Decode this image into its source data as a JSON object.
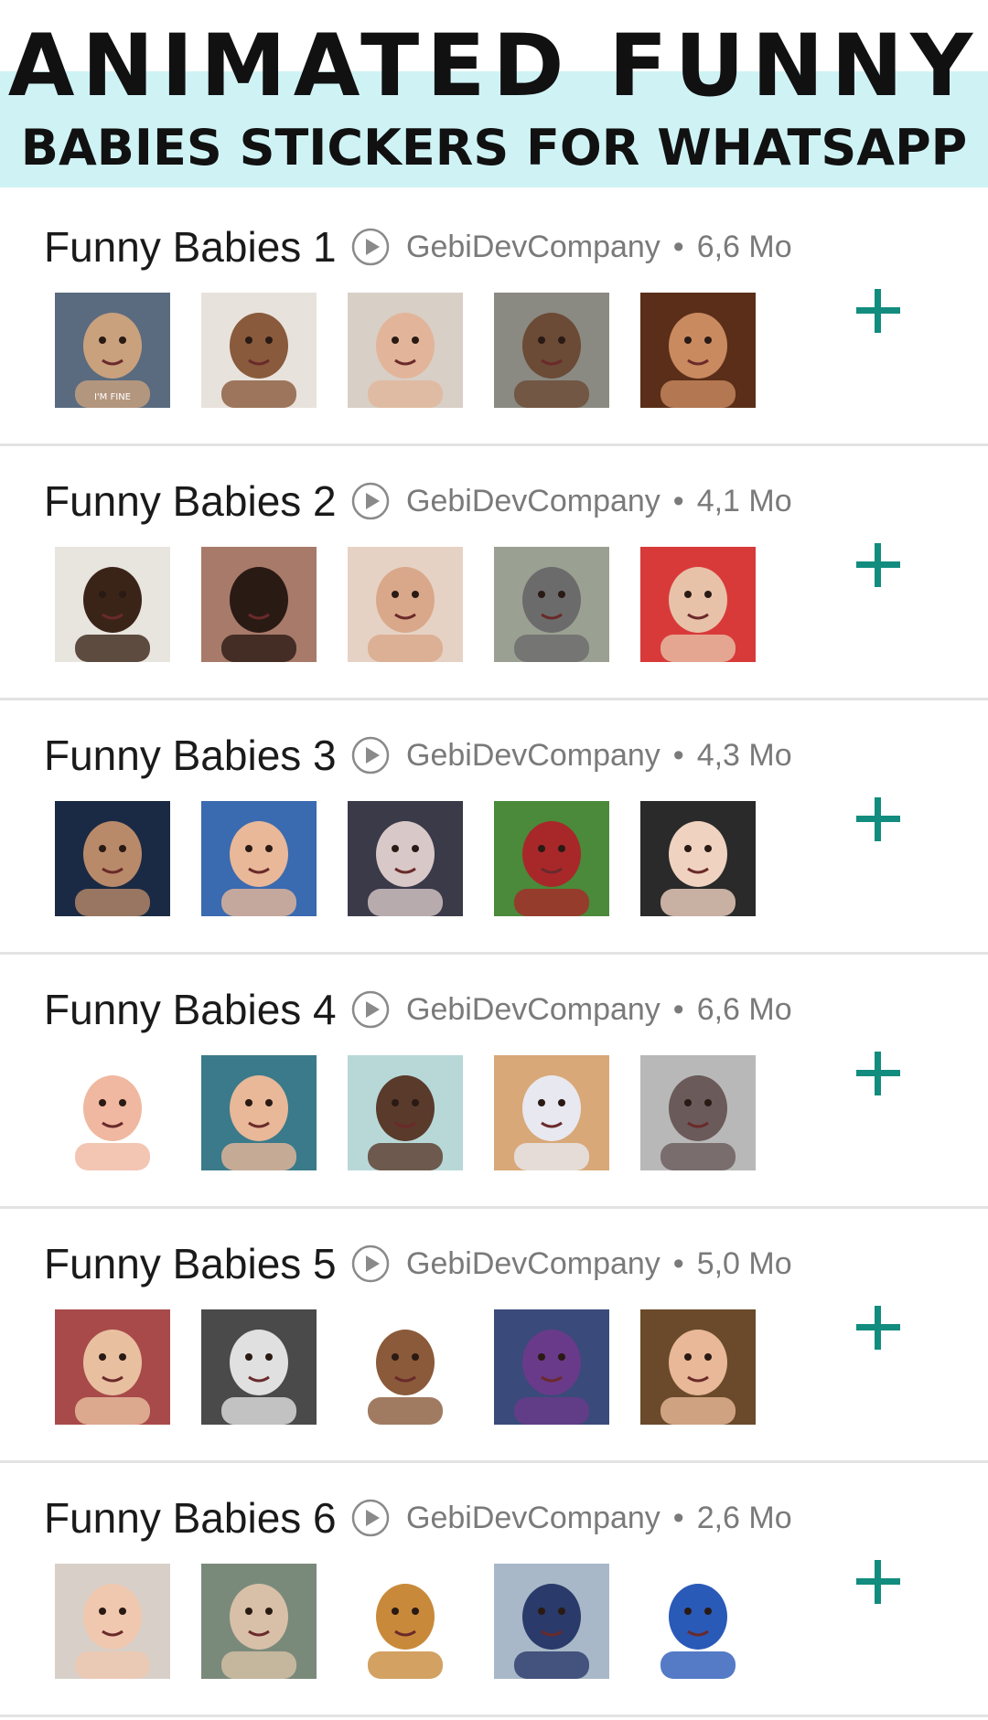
{
  "banner": {
    "title": "ANIMATED FUNNY",
    "subtitle": "BABIES STICKERS FOR WHATSAPP",
    "band_color": "#cff3f5"
  },
  "accent_color": "#128c7e",
  "packs": [
    {
      "name": "Funny Babies 1",
      "publisher": "GebiDevCompany",
      "size": "6,6 Mo",
      "stickers": [
        {
          "bg": "#5a6b80",
          "fg": "#c9a17d",
          "caption": "I'M FINE"
        },
        {
          "bg": "#e8e2dc",
          "fg": "#8a5a3c"
        },
        {
          "bg": "#d8cfc6",
          "fg": "#e2b59a"
        },
        {
          "bg": "#8a8a82",
          "fg": "#6b4a36"
        },
        {
          "bg": "#5a2e18",
          "fg": "#c98a60"
        }
      ]
    },
    {
      "name": "Funny Babies 2",
      "publisher": "GebiDevCompany",
      "size": "4,1 Mo",
      "stickers": [
        {
          "bg": "#e8e4de",
          "fg": "#3a2418"
        },
        {
          "bg": "#a87a6a",
          "fg": "#2a1a14"
        },
        {
          "bg": "#e6d2c4",
          "fg": "#d9a88a"
        },
        {
          "bg": "#9aa092",
          "fg": "#6b6b6b"
        },
        {
          "bg": "#d83a3a",
          "fg": "#e8c2a8"
        }
      ]
    },
    {
      "name": "Funny Babies 3",
      "publisher": "GebiDevCompany",
      "size": "4,3 Mo",
      "stickers": [
        {
          "bg": "#1a2a44",
          "fg": "#b98a6a"
        },
        {
          "bg": "#3a6ab0",
          "fg": "#e8b898"
        },
        {
          "bg": "#3a3a48",
          "fg": "#d8c8c8"
        },
        {
          "bg": "#4a8a3a",
          "fg": "#a8282a"
        },
        {
          "bg": "#2a2a2a",
          "fg": "#f0d2c0"
        }
      ]
    },
    {
      "name": "Funny Babies 4",
      "publisher": "GebiDevCompany",
      "size": "6,6 Mo",
      "stickers": [
        {
          "bg": "#ffffff",
          "fg": "#f0b8a0"
        },
        {
          "bg": "#3a7a8a",
          "fg": "#e8b898"
        },
        {
          "bg": "#b8d8d8",
          "fg": "#5a3a2a"
        },
        {
          "bg": "#d8a878",
          "fg": "#e8e8f0"
        },
        {
          "bg": "#b8b8b8",
          "fg": "#6a5a5a"
        }
      ]
    },
    {
      "name": "Funny Babies 5",
      "publisher": "GebiDevCompany",
      "size": "5,0 Mo",
      "stickers": [
        {
          "bg": "#a84a4a",
          "fg": "#e8c0a0"
        },
        {
          "bg": "#4a4a4a",
          "fg": "#e0e0e0"
        },
        {
          "bg": "#ffffff",
          "fg": "#8a5a3a"
        },
        {
          "bg": "#3a4a7a",
          "fg": "#6a3a8a"
        },
        {
          "bg": "#6a4a2a",
          "fg": "#e8b898"
        }
      ]
    },
    {
      "name": "Funny Babies 6",
      "publisher": "GebiDevCompany",
      "size": "2,6 Mo",
      "stickers": [
        {
          "bg": "#d8d0c8",
          "fg": "#f0c8b0"
        },
        {
          "bg": "#7a8a7a",
          "fg": "#d8c0a8"
        },
        {
          "bg": "#ffffff",
          "fg": "#c88a3a"
        },
        {
          "bg": "#a8b8c8",
          "fg": "#2a3a6a"
        },
        {
          "bg": "#ffffff",
          "fg": "#2a5ab8"
        }
      ]
    }
  ]
}
